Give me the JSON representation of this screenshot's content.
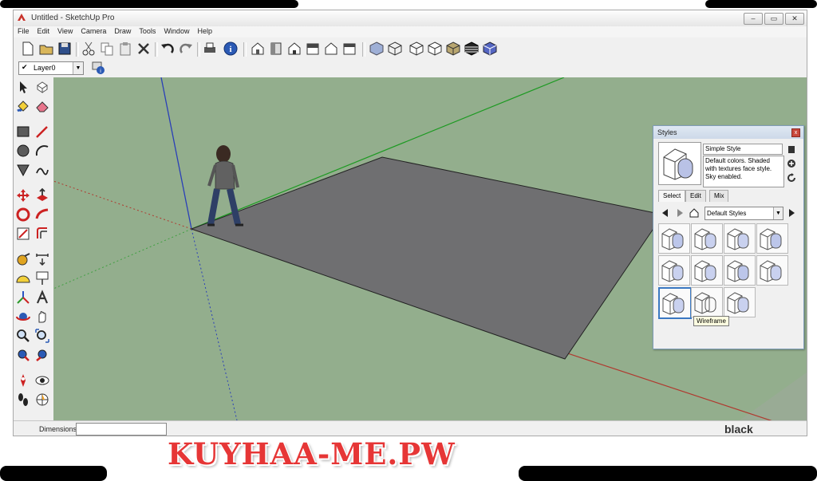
{
  "window": {
    "title": "Untitled - SketchUp Pro",
    "controls": [
      "–",
      "▭",
      "✕"
    ]
  },
  "menu": [
    "File",
    "Edit",
    "View",
    "Camera",
    "Draw",
    "Tools",
    "Window",
    "Help"
  ],
  "toolbar": {
    "icons": [
      "new-file-icon",
      "open-file-icon",
      "save-icon",
      "cut-icon",
      "copy-icon",
      "paste-icon",
      "erase-icon",
      "undo-icon",
      "redo-icon",
      "print-icon",
      "model-info-icon",
      "iso-view-icon",
      "top-view-icon",
      "front-view-icon",
      "right-view-icon",
      "back-view-icon",
      "left-view-icon",
      "xray-icon",
      "wireframe-icon",
      "hidden-line-icon",
      "shaded-icon",
      "shaded-texture-icon",
      "monochrome-icon",
      "back-edges-icon"
    ]
  },
  "layer": {
    "check": "✔",
    "name": "Layer0",
    "arrow": "▼"
  },
  "left_tools": [
    "select-icon",
    "make-component-icon",
    "paint-bucket-icon",
    "eraser-icon",
    "rectangle-icon",
    "line-icon",
    "circle-icon",
    "arc-icon",
    "polygon-icon",
    "freehand-icon",
    "move-icon",
    "push-pull-icon",
    "rotate-icon",
    "follow-me-icon",
    "scale-icon",
    "offset-icon",
    "tape-measure-icon",
    "dimension-icon",
    "protractor-icon",
    "text-icon",
    "axes-icon",
    "3d-text-icon",
    "orbit-icon",
    "pan-icon",
    "zoom-icon",
    "zoom-window-icon",
    "zoom-extents-icon",
    "previous-view-icon",
    "position-camera-icon",
    "look-around-icon",
    "walk-icon",
    "section-plane-icon"
  ],
  "status": {
    "dimensions_label": "Dimensions"
  },
  "styles_panel": {
    "title": "Styles",
    "close": "x",
    "style_name": "Simple Style",
    "style_desc": "Default colors.  Shaded with textures face style.  Sky enabled.",
    "tabs": [
      "Select",
      "Edit",
      "Mix"
    ],
    "collection": "Default Styles",
    "tooltip": "Wireframe"
  },
  "watermark": "KUYHAA-ME.PW",
  "brand": "black"
}
